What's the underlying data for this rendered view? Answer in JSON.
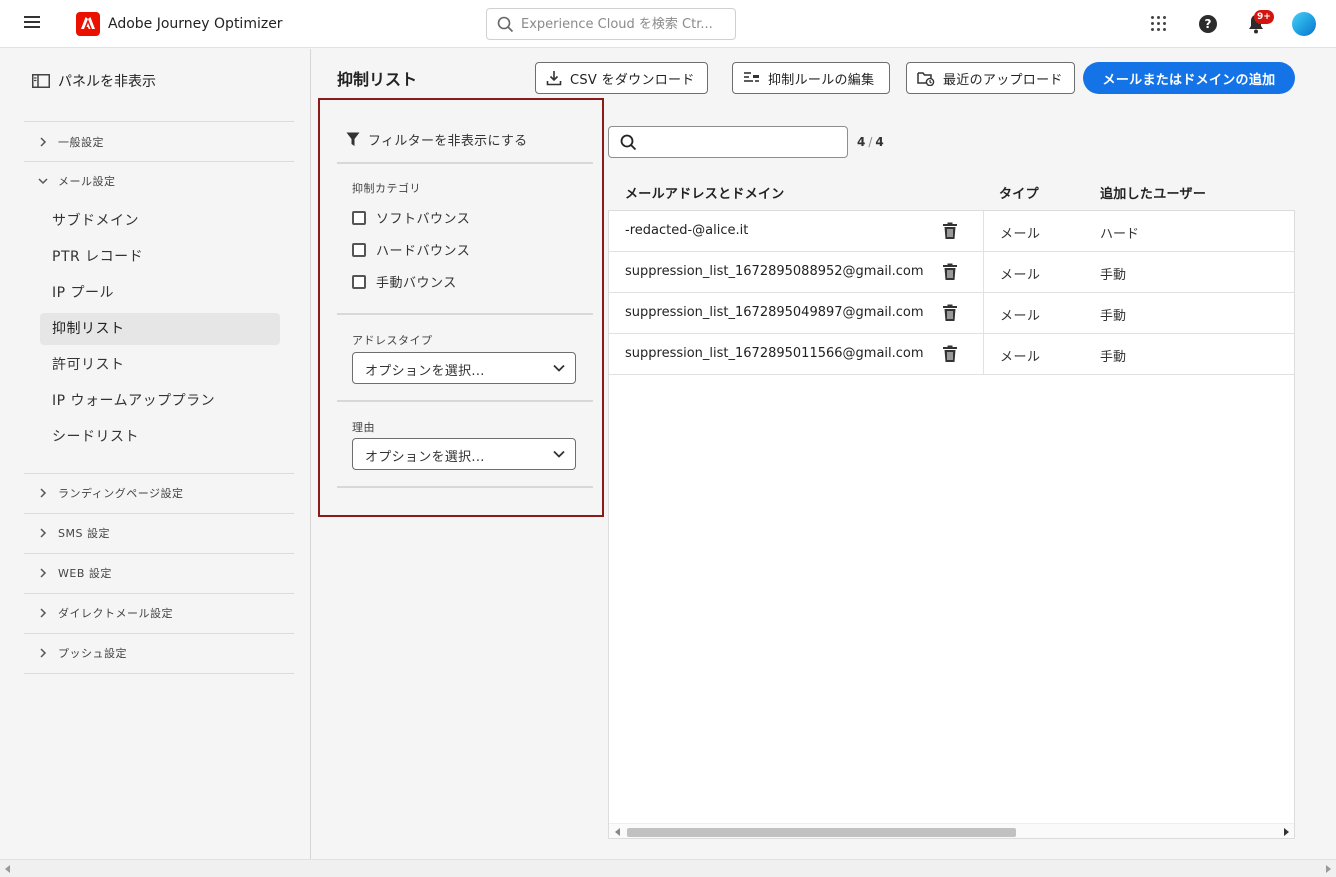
{
  "header": {
    "app_title": "Adobe Journey Optimizer",
    "search_placeholder": "Experience Cloud を検索 Ctr...",
    "notification_count": "9+",
    "brand_color": "#eb1000"
  },
  "sidebar": {
    "hide_panel_label": "パネルを非表示",
    "groups": [
      {
        "label": "一般設定",
        "expanded": false
      },
      {
        "label": "メール設定",
        "expanded": true
      },
      {
        "label": "ランディングページ設定",
        "expanded": false
      },
      {
        "label": "SMS 設定",
        "expanded": false
      },
      {
        "label": "WEB 設定",
        "expanded": false
      },
      {
        "label": "ダイレクトメール設定",
        "expanded": false
      },
      {
        "label": "プッシュ設定",
        "expanded": false
      }
    ],
    "email_items": [
      {
        "label": "サブドメイン"
      },
      {
        "label": "PTR レコード"
      },
      {
        "label": "IP プール"
      },
      {
        "label": "抑制リスト",
        "selected": true
      },
      {
        "label": "許可リスト"
      },
      {
        "label": "IP ウォームアッププラン"
      },
      {
        "label": "シードリスト"
      }
    ]
  },
  "main": {
    "title": "抑制リスト",
    "buttons": {
      "download_csv": "CSV をダウンロード",
      "edit_rules": "抑制ルールの編集",
      "recent_uploads": "最近のアップロード",
      "add": "メールまたはドメインの追加"
    },
    "accent_color": "#1473e6"
  },
  "filters": {
    "toggle_label": "フィルターを非表示にする",
    "category_label": "抑制カテゴリ",
    "categories": [
      "ソフトバウンス",
      "ハードバウンス",
      "手動バウンス"
    ],
    "address_type_label": "アドレスタイプ",
    "address_type_value": "オプションを選択...",
    "reason_label": "理由",
    "reason_value": "オプションを選択..."
  },
  "table": {
    "count_shown": "4",
    "count_total": "4",
    "columns": [
      "メールアドレスとドメイン",
      "タイプ",
      "追加したユーザー"
    ],
    "rows": [
      {
        "email": "-redacted-@alice.it",
        "type": "メール",
        "added_by": "ハード"
      },
      {
        "email": "suppression_list_1672895088952@gmail.com",
        "type": "メール",
        "added_by": "手動"
      },
      {
        "email": "suppression_list_1672895049897@gmail.com",
        "type": "メール",
        "added_by": "手動"
      },
      {
        "email": "suppression_list_1672895011566@gmail.com",
        "type": "メール",
        "added_by": "手動"
      }
    ]
  }
}
